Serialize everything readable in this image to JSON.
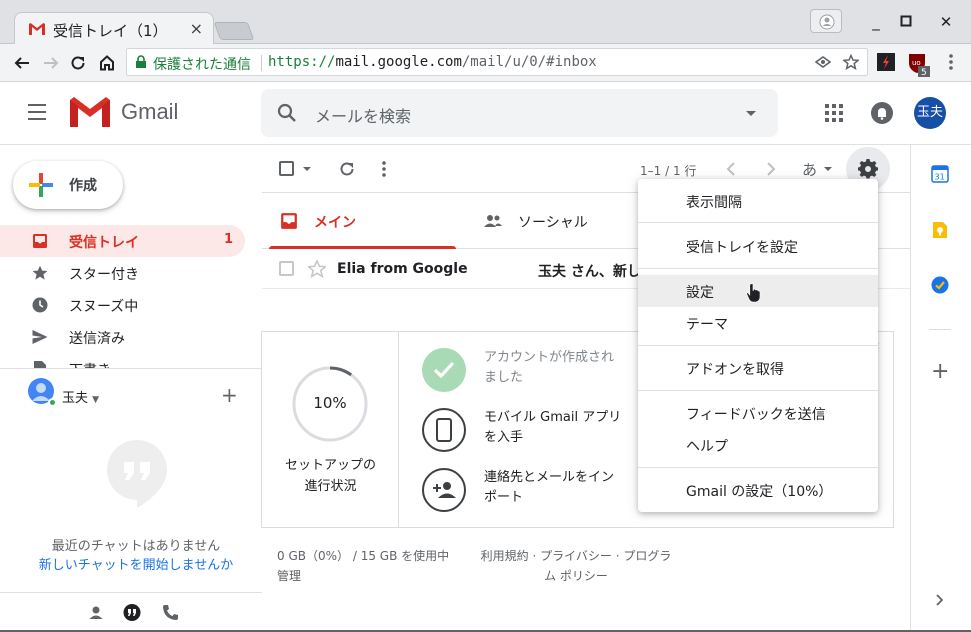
{
  "browser": {
    "tab_title": "受信トレイ（1）",
    "tab_close": "×",
    "secure_label": "保護された通信",
    "url_scheme": "https://",
    "url_host": "mail.google.com",
    "url_path": "/mail/u/0/#inbox",
    "ext_badge": "5",
    "window_min": "_",
    "window_max": "▢",
    "window_close": "✕"
  },
  "header": {
    "logo_text": "Gmail",
    "search_placeholder": "メールを検索",
    "avatar_text": "玉夫"
  },
  "sidebar": {
    "compose_label": "作成",
    "items": [
      {
        "label": "受信トレイ",
        "count": "1",
        "icon": "inbox-icon",
        "active": true
      },
      {
        "label": "スター付き",
        "count": "",
        "icon": "star-icon",
        "active": false
      },
      {
        "label": "スヌーズ中",
        "count": "",
        "icon": "clock-icon",
        "active": false
      },
      {
        "label": "送信済み",
        "count": "",
        "icon": "send-icon",
        "active": false
      },
      {
        "label": "下書き",
        "count": "",
        "icon": "draft-icon",
        "active": false
      }
    ],
    "hangouts": {
      "user_name": "玉夫",
      "empty_text": "最近のチャットはありません",
      "start_link": "新しいチャットを開始しませんか"
    }
  },
  "list": {
    "pager": "1–1 / 1 行",
    "input_lang": "あ",
    "tabs": [
      {
        "label": "メイン",
        "icon": "inbox-icon",
        "active": true
      },
      {
        "label": "ソーシャル",
        "icon": "people-icon",
        "active": false
      }
    ],
    "messages": [
      {
        "sender": "Elia from Google",
        "subject": "玉夫 さん、新し"
      }
    ]
  },
  "setup": {
    "progress_percent": 10,
    "progress_label": "10%",
    "label_line1": "セットアップの",
    "label_line2": "進行状況",
    "steps": [
      {
        "line1": "アカウントが作成され",
        "line2": "ました",
        "done": true,
        "icon": "check-icon"
      },
      {
        "line1": "モバイル Gmail アプリ",
        "line2": "を入手",
        "done": false,
        "icon": "phone-icon"
      },
      {
        "line1": "連絡先とメールをイン",
        "line2": "ポート",
        "done": false,
        "icon": "add-contact-icon"
      }
    ]
  },
  "footer": {
    "storage_line1": "0 GB（0%） / 15 GB を使用中",
    "storage_line2": "管理",
    "terms_line1": "利用規約 · プライバシー · プログラ",
    "terms_line2": "ム ポリシー"
  },
  "side_panel": {
    "calendar_day": "31"
  },
  "settings_menu": {
    "items": [
      {
        "label": "表示間隔"
      },
      {
        "label": "受信トレイを設定"
      },
      {
        "label": "設定"
      },
      {
        "label": "テーマ"
      },
      {
        "label": "アドオンを取得"
      },
      {
        "label": "フィードバックを送信"
      },
      {
        "label": "ヘルプ"
      },
      {
        "label": "Gmail の設定（10%）"
      }
    ]
  },
  "colors": {
    "accent_red": "#d93025",
    "link_blue": "#1a73e8",
    "secure_green": "#188038",
    "avatar_blue": "#174ea6"
  }
}
